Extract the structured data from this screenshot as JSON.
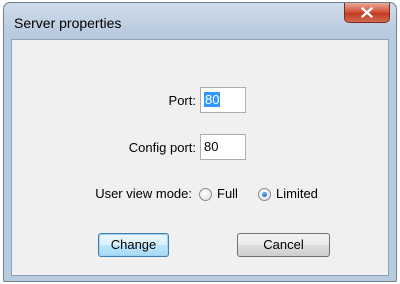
{
  "window": {
    "title": "Server properties"
  },
  "form": {
    "port": {
      "label": "Port:",
      "value": "80"
    },
    "config_port": {
      "label": "Config port:",
      "value": "80"
    },
    "user_view_mode": {
      "label": "User view mode:",
      "options": [
        "Full",
        "Limited"
      ],
      "selected": "Limited"
    }
  },
  "buttons": {
    "change": "Change",
    "cancel": "Cancel"
  },
  "icons": {
    "close": "close-icon"
  },
  "colors": {
    "selection": "#3399ff",
    "close_button": "#c23a22",
    "default_button_border": "#3c7fb1"
  }
}
